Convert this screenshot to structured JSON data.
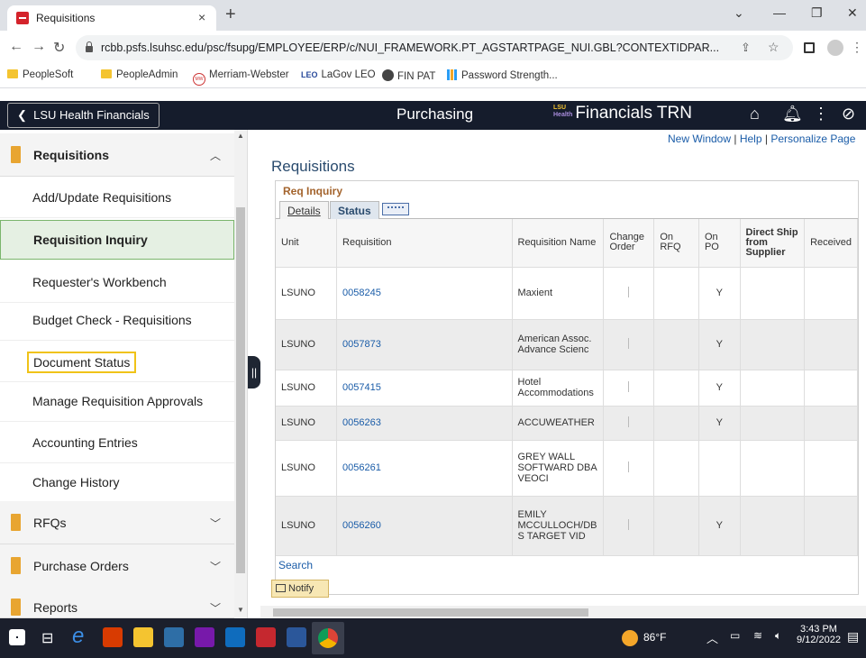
{
  "browser": {
    "tab_title": "Requisitions",
    "url": "rcbb.psfs.lsuhsc.edu/psc/fsupg/EMPLOYEE/ERP/c/NUI_FRAMEWORK.PT_AGSTARTPAGE_NUI.GBL?CONTEXTIDPAR...",
    "bookmarks": [
      "PeopleSoft",
      "PeopleAdmin",
      "Merriam-Webster",
      "LaGov LEO",
      "FIN PAT",
      "Password Strength..."
    ]
  },
  "header": {
    "back_label": "LSU Health Financials",
    "title": "Purchasing",
    "brand_lsu": "LSU",
    "brand_health": "Health",
    "brand_name": "Financials TRN"
  },
  "sidebar": {
    "section": "Requisitions",
    "items": [
      {
        "label": "Add/Update Requisitions"
      },
      {
        "label": "Requisition Inquiry"
      },
      {
        "label": "Requester's Workbench"
      },
      {
        "label": "Budget Check - Requisitions"
      },
      {
        "label": "Document Status"
      },
      {
        "label": "Manage Requisition Approvals"
      },
      {
        "label": "Accounting Entries"
      },
      {
        "label": "Change History"
      }
    ],
    "folders": [
      {
        "label": "RFQs"
      },
      {
        "label": "Purchase Orders"
      },
      {
        "label": "Reports"
      }
    ]
  },
  "main": {
    "links": {
      "new_window": "New Window",
      "help": "Help",
      "personalize": "Personalize Page"
    },
    "page_title": "Requisitions",
    "grid_title": "Req Inquiry",
    "tabs": [
      "Details",
      "Status"
    ],
    "columns": [
      "Unit",
      "Requisition",
      "Requisition Name",
      "Change Order",
      "On RFQ",
      "On PO",
      "Direct Ship from Supplier",
      "Received"
    ],
    "rows": [
      {
        "unit": "LSUNO",
        "req": "0058245",
        "name": "Maxient",
        "on_po": "Y"
      },
      {
        "unit": "LSUNO",
        "req": "0057873",
        "name": "American Assoc. Advance Scienc",
        "on_po": "Y"
      },
      {
        "unit": "LSUNO",
        "req": "0057415",
        "name": "Hotel Accommodations",
        "on_po": "Y"
      },
      {
        "unit": "LSUNO",
        "req": "0056263",
        "name": "ACCUWEATHER",
        "on_po": "Y"
      },
      {
        "unit": "LSUNO",
        "req": "0056261",
        "name": "GREY WALL SOFTWARD DBA VEOCI",
        "on_po": ""
      },
      {
        "unit": "LSUNO",
        "req": "0056260",
        "name": "EMILY MCCULLOCH/DB S TARGET VID",
        "on_po": "Y"
      }
    ],
    "search_label": "Search",
    "notify_label": "Notify"
  },
  "taskbar": {
    "temp": "86°F",
    "time": "3:43 PM",
    "date": "9/12/2022"
  },
  "colors": {
    "header_bg": "#151c2c",
    "active_item_bg": "#e5f0e3",
    "link": "#1a5ca8",
    "grid_title": "#a3632c"
  }
}
